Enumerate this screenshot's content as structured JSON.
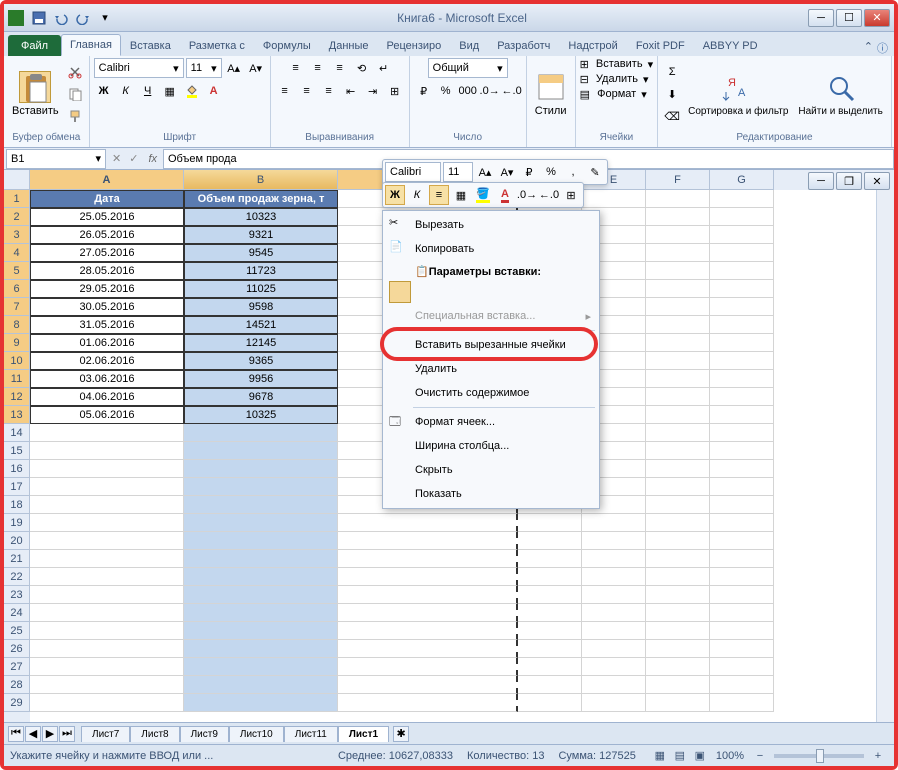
{
  "title": "Книга6 - Microsoft Excel",
  "tabs": {
    "file": "Файл",
    "home": "Главная",
    "insert": "Вставка",
    "layout": "Разметка с",
    "formulas": "Формулы",
    "data": "Данные",
    "review": "Рецензиро",
    "view": "Вид",
    "developer": "Разработч",
    "addins": "Надстрой",
    "foxit": "Foxit PDF",
    "abbyy": "ABBYY PD"
  },
  "ribbon": {
    "clipboard": {
      "label": "Буфер обмена",
      "paste": "Вставить"
    },
    "font": {
      "label": "Шрифт",
      "name": "Calibri",
      "size": "11"
    },
    "alignment": {
      "label": "Выравнивания"
    },
    "number": {
      "label": "Число",
      "format": "Общий"
    },
    "styles": {
      "label": "Стили"
    },
    "cells": {
      "label": "Ячейки",
      "insert": "Вставить",
      "delete": "Удалить",
      "format": "Формат"
    },
    "editing": {
      "label": "Редактирование",
      "sort": "Сортировка и фильтр",
      "find": "Найти и выделить"
    }
  },
  "namebox": "B1",
  "formula": "Объем прода",
  "columns": [
    "A",
    "B",
    "C",
    "D",
    "E",
    "F",
    "G"
  ],
  "headers": {
    "a": "Дата",
    "b": "Объем продаж зерна, т"
  },
  "rows": [
    {
      "n": 1
    },
    {
      "n": 2,
      "a": "25.05.2016",
      "b": "10323"
    },
    {
      "n": 3,
      "a": "26.05.2016",
      "b": "9321"
    },
    {
      "n": 4,
      "a": "27.05.2016",
      "b": "9545"
    },
    {
      "n": 5,
      "a": "28.05.2016",
      "b": "11723"
    },
    {
      "n": 6,
      "a": "29.05.2016",
      "b": "11025"
    },
    {
      "n": 7,
      "a": "30.05.2016",
      "b": "9598"
    },
    {
      "n": 8,
      "a": "31.05.2016",
      "b": "14521"
    },
    {
      "n": 9,
      "a": "01.06.2016",
      "b": "12145"
    },
    {
      "n": 10,
      "a": "02.06.2016",
      "b": "9365"
    },
    {
      "n": 11,
      "a": "03.06.2016",
      "b": "9956"
    },
    {
      "n": 12,
      "a": "04.06.2016",
      "b": "9678"
    },
    {
      "n": 13,
      "a": "05.06.2016",
      "b": "10325"
    },
    {
      "n": 14
    },
    {
      "n": 15
    },
    {
      "n": 16
    },
    {
      "n": 17
    },
    {
      "n": 18
    },
    {
      "n": 19
    },
    {
      "n": 20
    },
    {
      "n": 21
    },
    {
      "n": 22
    },
    {
      "n": 23
    },
    {
      "n": 24
    },
    {
      "n": 25
    },
    {
      "n": 26
    },
    {
      "n": 27
    },
    {
      "n": 28
    },
    {
      "n": 29
    }
  ],
  "mini": {
    "font": "Calibri",
    "size": "11"
  },
  "context": {
    "cut": "Вырезать",
    "copy": "Копировать",
    "paste_opts": "Параметры вставки:",
    "paste_special": "Специальная вставка...",
    "insert_cut": "Вставить вырезанные ячейки",
    "delete": "Удалить",
    "clear": "Очистить содержимое",
    "format": "Формат ячеек...",
    "colwidth": "Ширина столбца...",
    "hide": "Скрыть",
    "show": "Показать"
  },
  "sheets": {
    "s7": "Лист7",
    "s8": "Лист8",
    "s9": "Лист9",
    "s10": "Лист10",
    "s11": "Лист11",
    "s1": "Лист1"
  },
  "status": {
    "msg": "Укажите ячейку и нажмите ВВОД или ...",
    "avg_lbl": "Среднее:",
    "avg": "10627,08333",
    "count_lbl": "Количество:",
    "count": "13",
    "sum_lbl": "Сумма:",
    "sum": "127525",
    "zoom": "100%"
  }
}
